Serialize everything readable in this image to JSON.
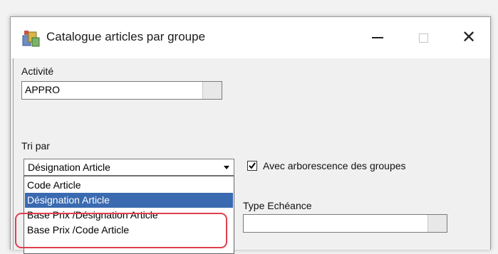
{
  "window": {
    "title": "Catalogue articles par groupe",
    "icon": "catalogue-app-icon",
    "controls": {
      "minimize": "—",
      "maximize": "□",
      "close": "✕"
    }
  },
  "form": {
    "activite": {
      "label": "Activité",
      "value": "APPRO"
    },
    "tri_par": {
      "label": "Tri par",
      "selected": "Désignation Article",
      "options": [
        "Code Article",
        "Désignation Article",
        "Base Prix /Désignation Article",
        "Base Prix /Code Article"
      ]
    },
    "arborescence": {
      "label": "Avec arborescence des groupes",
      "checked": true
    },
    "type_echeance": {
      "label": "Type Echéance",
      "value": ""
    }
  },
  "colors": {
    "selection": "#3a6ab0",
    "highlight": "#e0404f"
  }
}
